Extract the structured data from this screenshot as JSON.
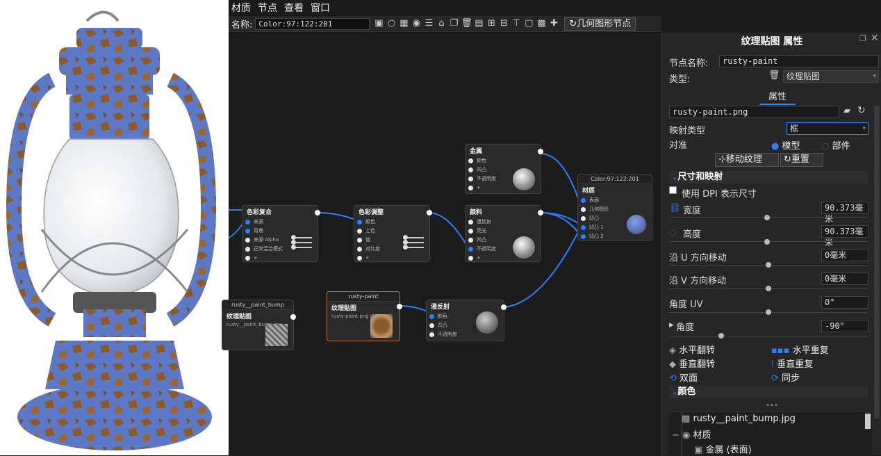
{
  "menu": [
    "材质",
    "节点",
    "查看",
    "窗口"
  ],
  "toolbar": {
    "name_label": "名称:",
    "name_value": "Color:97:122:201",
    "geometry_button": "几何图形节点"
  },
  "nodes": {
    "metal": {
      "title": "金属",
      "ports": [
        "颜色",
        "凹凸",
        "不透明度",
        "+"
      ]
    },
    "color_mix": {
      "title": "色彩复合",
      "ports": [
        "来源",
        "背景",
        "来源 Alpha",
        "正常混合模式",
        "+"
      ]
    },
    "color_adjust": {
      "title": "色彩调整",
      "ports": [
        "颜色",
        "上色",
        "值",
        "对比度",
        "+"
      ]
    },
    "paint": {
      "title": "颜料",
      "ports": [
        "漫反射",
        "亮光",
        "凹凸",
        "不透明度",
        "+"
      ]
    },
    "material": {
      "header": "Color:97:122:201",
      "title": "材质",
      "ports": [
        "表面",
        "几何图形",
        "凹凸",
        "凹凸 1",
        "凹凸 2"
      ]
    },
    "bump_tex": {
      "header": "rusty__paint_bump",
      "title": "纹理贴图",
      "file": "rusty__paint_bump.jpg"
    },
    "rust_tex": {
      "header": "rusty-paint",
      "title": "纹理贴图",
      "file": "rusty-paint.png"
    },
    "diffuse": {
      "title": "漫反射",
      "ports": [
        "颜色",
        "凹凸",
        "不透明度"
      ]
    }
  },
  "panel": {
    "title": "纹理贴图 属性",
    "node_name_label": "节点名称:",
    "node_name_value": "rusty-paint",
    "type_label": "类型:",
    "type_value": "纹理贴图",
    "tab": "属性",
    "file": "rusty-paint.png",
    "mapping_label": "映射类型",
    "mapping_value": "框",
    "align_label": "对准",
    "align_model": "模型",
    "align_part": "部件",
    "move_texture_button": "移动纹理",
    "reset_button": "重置",
    "section_size": "尺寸和映射",
    "dpi_label": "使用 DPI 表示尺寸",
    "width_label": "宽度",
    "width_value": "90.373毫米",
    "height_label": "高度",
    "height_value": "90.373毫米",
    "u_move_label": "沿 U 方向移动",
    "u_move_value": "0毫米",
    "v_move_label": "沿 V 方向移动",
    "v_move_value": "0毫米",
    "angle_uv_label": "角度 UV",
    "angle_uv_value": "0°",
    "angle_label": "角度",
    "angle_value": "-90°",
    "flip_h": "水平翻转",
    "repeat_h": "水平重复",
    "flip_v": "垂直翻转",
    "repeat_v": "垂直重复",
    "double_sided": "双面",
    "sync": "同步",
    "section_color": "颜色",
    "more": "•••"
  },
  "tree": {
    "item1": "rusty__paint_bump.jpg",
    "item2": "材质",
    "item3": "金属 (表面)"
  },
  "colors": {
    "accent": "#2a7fff",
    "paint_blue": "#5d78c4",
    "rust": "#8a5a2e"
  }
}
